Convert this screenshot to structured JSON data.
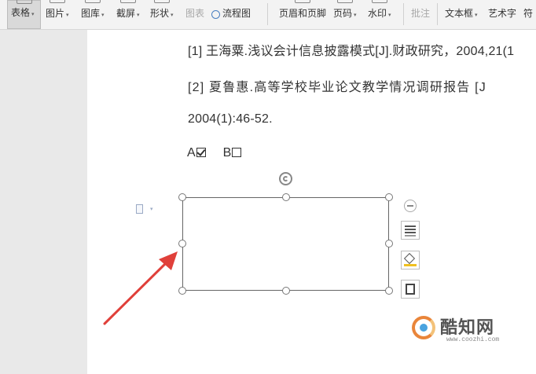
{
  "toolbar": {
    "items": [
      {
        "label": "表格",
        "caret": "▾"
      },
      {
        "label": "图片",
        "caret": "▾"
      },
      {
        "label": "图库",
        "caret": "▾"
      },
      {
        "label": "截屏",
        "caret": "▾"
      },
      {
        "label": "形状",
        "caret": "▾"
      },
      {
        "label": "图表"
      },
      {
        "label": "流程图"
      },
      {
        "label": "页眉和页脚"
      },
      {
        "label": "页码",
        "caret": "▾"
      },
      {
        "label": "水印",
        "caret": "▾"
      },
      {
        "label": "批注"
      },
      {
        "label": "文本框",
        "caret": "▾"
      },
      {
        "label": "艺术字"
      },
      {
        "label": "符"
      }
    ]
  },
  "document": {
    "ref1": "[1]  王海粟.浅议会计信息披露模式[J].财政研究，2004,21(1",
    "ref2": "[2]  夏鲁惠.高等学校毕业论文教学情况调研报告 [J",
    "ref2_cont": "2004(1):46-52.",
    "option_a": "A",
    "option_b": "B"
  },
  "watermark": {
    "text": "酷知网",
    "url": "www.coozhi.com"
  },
  "colors": {
    "arrow": "#e0403a",
    "ribbon_bg": "#f3f3f3",
    "page_bg": "#ffffff"
  }
}
